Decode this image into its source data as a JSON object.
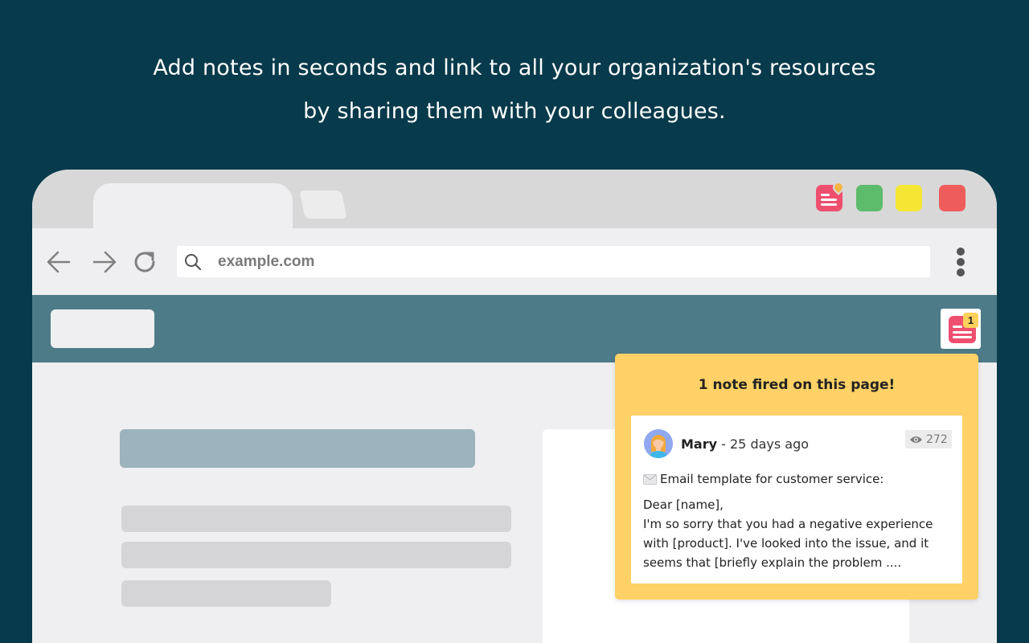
{
  "headline": {
    "line1": "Add notes in seconds and link to all your organization's resources",
    "line2": "by sharing them with your colleagues."
  },
  "browser": {
    "extensions": [
      {
        "icon": "notes-extension-icon",
        "color": "#ef4f6f"
      },
      {
        "icon": "green-extension-icon",
        "color": "#5cbc6b"
      },
      {
        "icon": "yellow-extension-icon",
        "color": "#f4e633"
      },
      {
        "icon": "red-extension-icon",
        "color": "#ee5d5b"
      }
    ],
    "nav": {
      "back_icon": "arrow-left-icon",
      "forward_icon": "arrow-right-icon",
      "reload_icon": "reload-icon",
      "menu_icon": "kebab-menu-icon"
    },
    "url": "example.com"
  },
  "site": {
    "notes_button_icon": "notes-icon",
    "notes_count": "1"
  },
  "popup": {
    "title": "1 note fired on this page!",
    "note": {
      "author": "Mary",
      "separator": " - ",
      "time": "25 days ago",
      "views": "272",
      "subject_icon": "envelope-icon",
      "subject": "Email template for customer service:",
      "body_lines": [
        "Dear [name],",
        "I'm so sorry that you had a negative experience",
        "with [product]. I've looked into the issue, and it",
        "seems that [briefly explain the problem ...."
      ]
    }
  },
  "colors": {
    "background": "#073a4b",
    "site_header": "#4d7b88",
    "popup": "#ffd166",
    "notes_accent": "#ef4f6f"
  }
}
